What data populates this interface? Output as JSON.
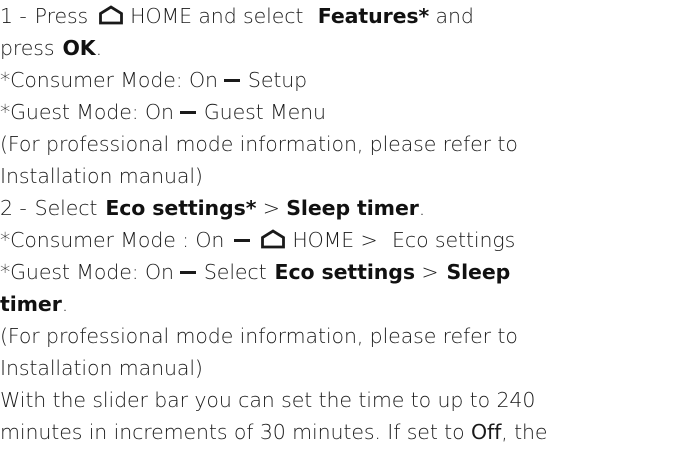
{
  "doc": {
    "l1": {
      "num": "1 -",
      "press": "Press",
      "home": "HOME",
      "select": "and select",
      "features": "Features*",
      "and": "and"
    },
    "l2": {
      "press": "press",
      "ok": "OK",
      "period": "."
    },
    "l3": {
      "consumer": "*Consumer Mode: On",
      "setup": "Setup"
    },
    "l4": {
      "guest": "*Guest Mode: On",
      "guest_menu": "Guest Menu"
    },
    "l5": "(For professional mode information, please refer to",
    "l6": "Installation manual)",
    "l7": {
      "num": "2 -",
      "select": "Select",
      "eco": "Eco settings*",
      "gt": ">",
      "sleep": "Sleep timer",
      "period": "."
    },
    "l8": {
      "consumer": "*Consumer Mode : On",
      "home": "HOME",
      "gt": ">",
      "eco": "Eco settings"
    },
    "l9": {
      "guest": "*Guest Mode: On",
      "select": "Select",
      "eco": "Eco settings",
      "gt": ">",
      "sleep": "Sleep"
    },
    "l10": {
      "timer": "timer",
      "period": "."
    },
    "l11": "(For professional mode information, please refer to",
    "l12": "Installation manual)",
    "l13": "With the slider bar you can set the time to up to 240",
    "l14": {
      "pre": "minutes in increments of 30 minutes. If set to",
      "off": "Off",
      "post": ", the"
    }
  }
}
